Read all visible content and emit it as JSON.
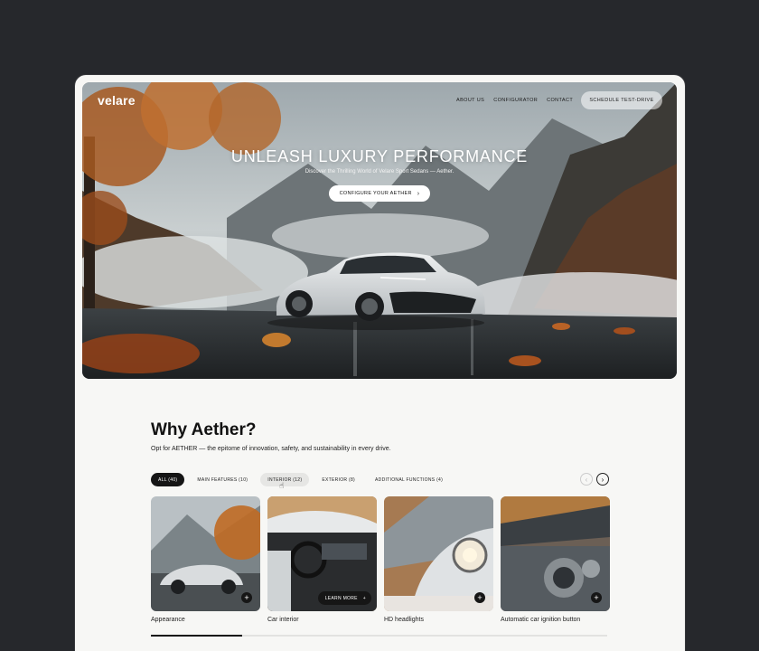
{
  "brand": {
    "logo_text": "velare"
  },
  "nav": {
    "links": [
      "ABOUT US",
      "CONFIGURATOR",
      "CONTACT"
    ],
    "cta": "SCHEDULE TEST-DRIVE"
  },
  "hero": {
    "title": "UNLEASH LUXURY PERFORMANCE",
    "subtitle": "Discover the Thrilling World of Velare Sport Sedans — Aether.",
    "button": "CONFIGURE YOUR AETHER",
    "button_icon": "chevron-right-icon"
  },
  "section": {
    "title": "Why Aether?",
    "subtitle": "Opt for AETHER — the epitome of innovation, safety, and sustainability in every drive."
  },
  "tabs": [
    {
      "label": "ALL (40)",
      "state": "active"
    },
    {
      "label": "MAIN FEATURES (10)",
      "state": "default"
    },
    {
      "label": "INTERIOR (12)",
      "state": "hover"
    },
    {
      "label": "EXTERIOR (8)",
      "state": "default"
    },
    {
      "label": "ADDITIONAL FUNCTIONS (4)",
      "state": "default"
    }
  ],
  "carousel": {
    "prev_icon": "chevron-left-icon",
    "next_icon": "chevron-right-icon",
    "progress": 0.2
  },
  "cards": [
    {
      "label": "Appearance",
      "icon": "plus-icon"
    },
    {
      "label": "Car interior",
      "hover_label": "LEARN MORE",
      "icon": "plus-icon"
    },
    {
      "label": "HD headlights",
      "icon": "plus-icon"
    },
    {
      "label": "Automatic car ignition button",
      "icon": "plus-icon"
    }
  ],
  "colors": {
    "page_bg": "#26282c",
    "frame_bg": "#f7f7f5",
    "accent_dark": "#151515"
  }
}
